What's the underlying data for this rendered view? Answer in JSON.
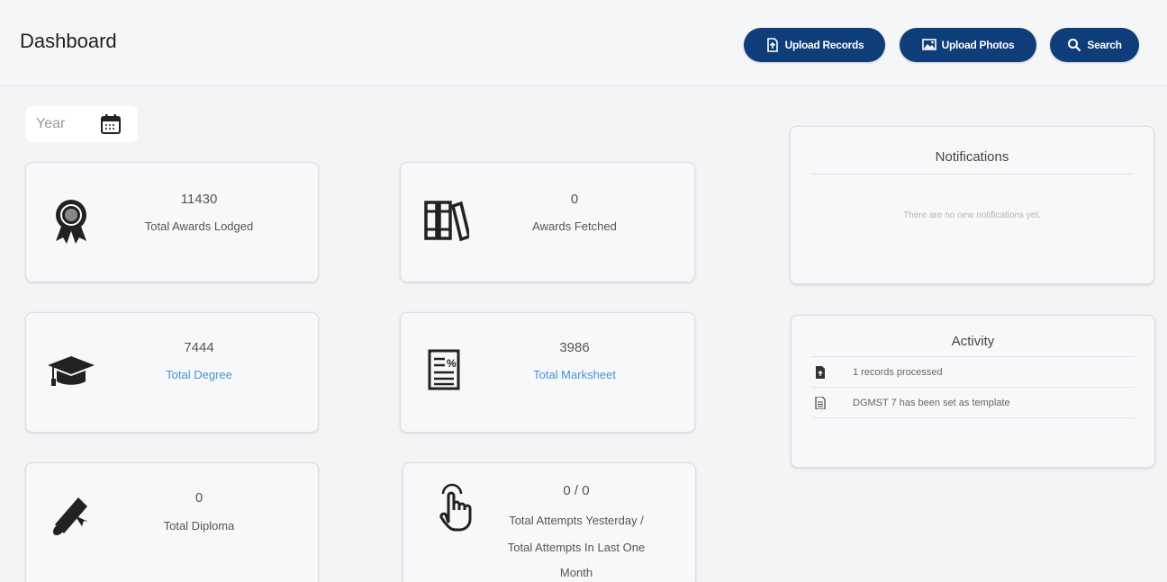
{
  "header": {
    "title": "Dashboard",
    "buttons": {
      "upload_records": "Upload Records",
      "upload_photos": "Upload Photos",
      "search": "Search"
    },
    "accent": "#0f3d7a"
  },
  "filter": {
    "year_placeholder": "Year",
    "icon": "calendar-icon"
  },
  "cards": {
    "awards_lodged": {
      "value": "11430",
      "label": "Total Awards Lodged",
      "icon": "award-ribbon-icon"
    },
    "awards_fetched": {
      "value": "0",
      "label": "Awards Fetched",
      "icon": "books-icon"
    },
    "degree": {
      "value": "7444",
      "label": "Total Degree",
      "icon": "graduation-cap-icon"
    },
    "marksheet": {
      "value": "3986",
      "label": "Total Marksheet",
      "icon": "marksheet-icon"
    },
    "diploma": {
      "value": "0",
      "label": "Total Diploma",
      "icon": "diploma-scroll-icon"
    },
    "attempts": {
      "value": "0 / 0",
      "label_line1": "Total Attempts Yesterday /",
      "label_line2": "Total Attempts In Last One",
      "label_line3": "Month",
      "icon": "pointer-hand-icon"
    }
  },
  "notifications": {
    "title": "Notifications",
    "empty": "There are no new notifications yet."
  },
  "activity": {
    "title": "Activity",
    "items": [
      {
        "text": "1 records processed",
        "icon": "file-upload-icon"
      },
      {
        "text": "DGMST 7 has been set as template",
        "icon": "document-icon"
      }
    ]
  },
  "link_color": "#4a90d9"
}
